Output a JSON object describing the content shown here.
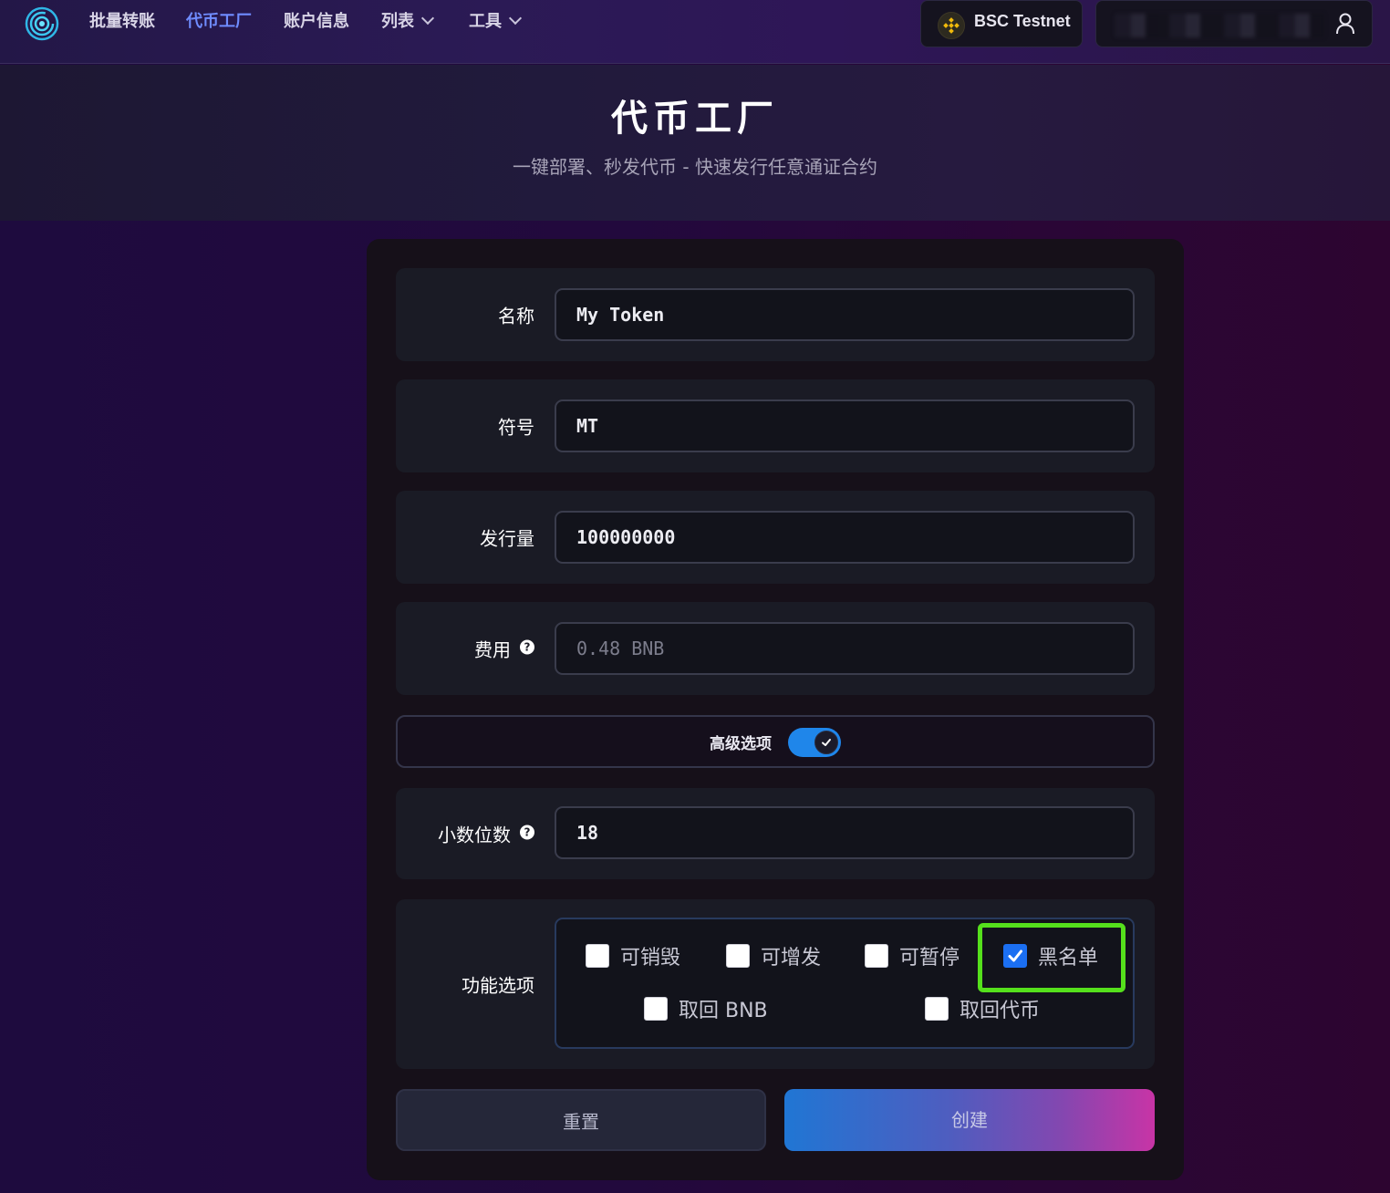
{
  "nav": {
    "items": [
      {
        "label": "批量转账",
        "active": false
      },
      {
        "label": "代币工厂",
        "active": true
      },
      {
        "label": "账户信息",
        "active": false
      },
      {
        "label": "列表",
        "active": false,
        "dropdown": true
      },
      {
        "label": "工具",
        "active": false,
        "dropdown": true
      }
    ],
    "network_label": "BSC Testnet",
    "network_icon": "bnb-icon",
    "account_icon": "user-icon"
  },
  "hero": {
    "title": "代币工厂",
    "subtitle": "一键部署、秒发代币 - 快速发行任意通证合约"
  },
  "form": {
    "name": {
      "label": "名称",
      "value": "My Token"
    },
    "symbol": {
      "label": "符号",
      "value": "MT"
    },
    "supply": {
      "label": "发行量",
      "value": "100000000"
    },
    "fee": {
      "label": "费用",
      "value": "0.48 BNB",
      "readonly": true
    },
    "advanced": {
      "label": "高级选项",
      "enabled": true
    },
    "decimals": {
      "label": "小数位数",
      "value": "18"
    },
    "features": {
      "label": "功能选项",
      "options": [
        {
          "label": "可销毁",
          "checked": false
        },
        {
          "label": "可增发",
          "checked": false
        },
        {
          "label": "可暂停",
          "checked": false
        },
        {
          "label": "黑名单",
          "checked": true,
          "highlighted": true
        },
        {
          "label": "取回 BNB",
          "checked": false
        },
        {
          "label": "取回代币",
          "checked": false
        }
      ]
    },
    "reset_label": "重置",
    "create_label": "创建"
  },
  "colors": {
    "accent": "#6f8cff",
    "toggle_on": "#1f86ea",
    "checkbox_checked": "#1b6ff2",
    "highlight": "#55e01c",
    "create_gradient_start": "#2076d4",
    "create_gradient_end": "#c834a6"
  }
}
